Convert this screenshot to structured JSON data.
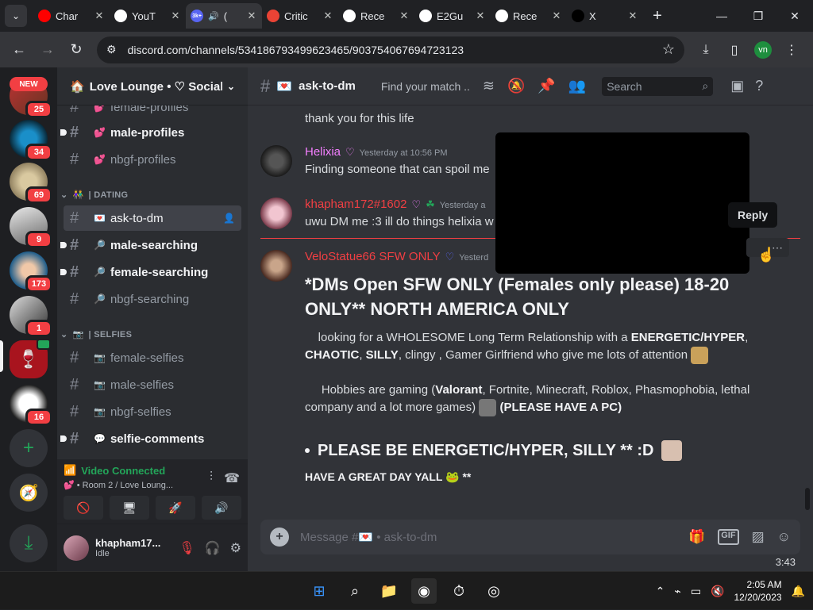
{
  "browser": {
    "tabs": [
      {
        "title": "Char",
        "favicon": "youtube-icon",
        "color": "#ff0000"
      },
      {
        "title": "YouT",
        "favicon": "google-icon",
        "color": "#ffffff"
      },
      {
        "title": "(",
        "favicon": "discord-icon",
        "color": "#5865f2",
        "badge": "3k+"
      },
      {
        "title": "Critic",
        "favicon": "gmail-icon",
        "color": "#ea4335"
      },
      {
        "title": "Rece",
        "favicon": "google-icon",
        "color": "#ffffff"
      },
      {
        "title": "E2Gu",
        "favicon": "google-icon",
        "color": "#ffffff"
      },
      {
        "title": "Rece",
        "favicon": "google-icon",
        "color": "#ffffff"
      },
      {
        "title": "X",
        "favicon": "x-icon",
        "color": "#000000"
      }
    ],
    "url": "discord.com/channels/534186793499623465/903754067694723123",
    "profile_initials": "vn"
  },
  "servers": {
    "new_label": "NEW",
    "badges": [
      "25",
      "34",
      "69",
      "9",
      "173",
      "1",
      "16"
    ]
  },
  "guild": {
    "name": "Love Lounge • ♡ Social",
    "channels_top": [
      {
        "name": "female-profiles",
        "emoji": "💕"
      },
      {
        "name": "male-profiles",
        "emoji": "💕"
      },
      {
        "name": "nbgf-profiles",
        "emoji": "💕"
      }
    ],
    "category_dating": "| DATING",
    "dating_channels": [
      {
        "name": "ask-to-dm",
        "emoji": "💌"
      },
      {
        "name": "male-searching",
        "emoji": "🔎"
      },
      {
        "name": "female-searching",
        "emoji": "🔎"
      },
      {
        "name": "nbgf-searching",
        "emoji": "🔎"
      }
    ],
    "category_selfies": "| SELFIES",
    "selfie_channels": [
      {
        "name": "female-selfies",
        "emoji": "📷"
      },
      {
        "name": "male-selfies",
        "emoji": "📷"
      },
      {
        "name": "nbgf-selfies",
        "emoji": "📷"
      },
      {
        "name": "selfie-comments",
        "emoji": "💬"
      }
    ]
  },
  "voice": {
    "status": "Video Connected",
    "room": "Room 2 / Love Loung..."
  },
  "user": {
    "name": "khapham17...",
    "status": "Idle"
  },
  "channel_header": {
    "name": "ask-to-dm",
    "emoji": "💌",
    "topic": "Find your match ...",
    "search_placeholder": "Search"
  },
  "messages": [
    {
      "text": "thank you for this life"
    },
    {
      "author": "Helixia",
      "author_color": "#f47fff",
      "time": "Yesterday at 10:56 PM",
      "text": "Finding someone that can spoil me"
    },
    {
      "author": "khapham172#1602",
      "author_color": "#f23f43",
      "time": "Yesterday a",
      "text": "uwu DM me :3 ill do things helixia w"
    },
    {
      "author": "VeloStatue66 SFW ONLY",
      "author_color": "#f23f43",
      "time": "Yesterd"
    }
  ],
  "post": {
    "heading": "*DMs Open SFW ONLY (Females only please) 18-20 ONLY** NORTH AMERICA ONLY",
    "p1_a": "looking for a WHOLESOME Long Term Relationship with a ",
    "p1_b": "ENERGETIC/HYPER",
    "p1_c": ", ",
    "p1_d": "CHAOTIC",
    "p1_e": ", ",
    "p1_f": "SILLY",
    "p1_g": ", clingy ,  Gamer Girlfriend who give me lots of attention",
    "p2_a": "Hobbies are gaming (",
    "p2_b": "Valorant",
    "p2_c": ", Fortnite, Minecraft, Roblox, Phasmophobia, lethal company and a lot more games)",
    "p2_d": "(PLEASE HAVE A PC)",
    "bullet": "PLEASE BE ENERGETIC/HYPER, SILLY ** :D",
    "closing": "HAVE A GREAT DAY YALL",
    "closing_tail": "**"
  },
  "tooltip": "Reply",
  "composer": {
    "placeholder_prefix": "Message #",
    "placeholder_channel": "ask-to-dm",
    "emoji": "💌"
  },
  "app_clock": "3:43",
  "taskbar": {
    "time": "2:05 AM",
    "date": "12/20/2023"
  }
}
